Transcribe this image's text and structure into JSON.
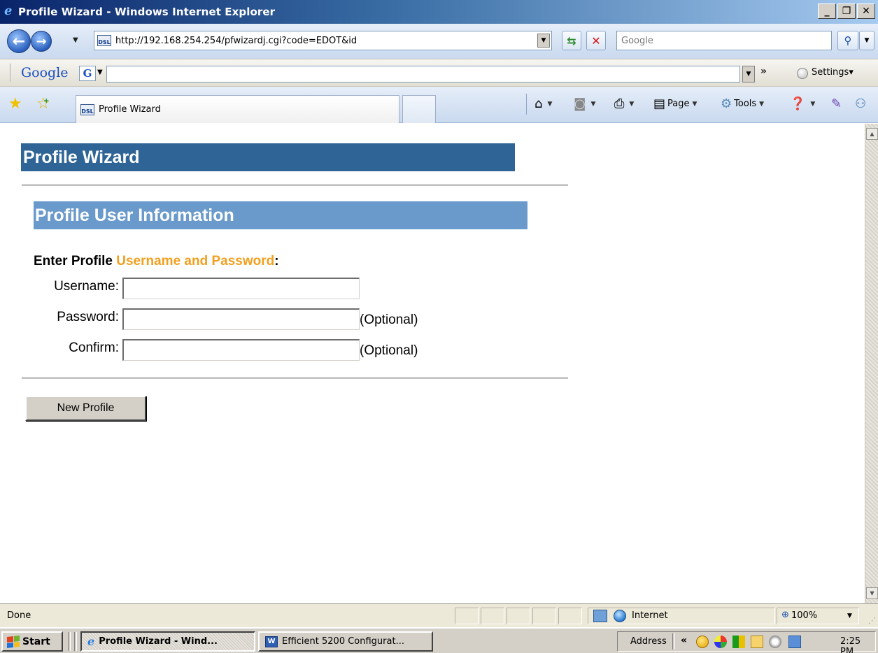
{
  "window": {
    "title": "Profile Wizard - Windows Internet Explorer",
    "minimize_glyph": "_",
    "maximize_glyph": "❐",
    "close_glyph": "✕"
  },
  "address_bar": {
    "url": "http://192.168.254.254/pfwizardj.cgi?code=EDOT&id",
    "site_icon_text": "DSL",
    "search_placeholder": "Google"
  },
  "google_toolbar": {
    "logo": "Google",
    "g_button": "G",
    "chevron": "»",
    "settings_label": "Settings"
  },
  "tabs": {
    "active_tab_label": "Profile Wizard"
  },
  "command_bar": {
    "page_label": "Page",
    "tools_label": "Tools"
  },
  "page": {
    "header_title": "Profile Wizard",
    "section_title": "Profile User Information",
    "prompt_prefix": "Enter Profile ",
    "prompt_highlight": "Username and Password",
    "prompt_suffix": ":",
    "username_label": "Username:",
    "username_value": "",
    "password_label": "Password:",
    "password_value": "",
    "password_hint": "(Optional)",
    "confirm_label": "Confirm:",
    "confirm_value": "",
    "confirm_hint": "(Optional)",
    "new_profile_button": "New Profile",
    "colors": {
      "header_bg": "#2e6596",
      "section_bg": "#6a9acb",
      "highlight": "#f0a020"
    }
  },
  "status_bar": {
    "status_text": "Done",
    "zone_text": "Internet",
    "zoom_text": "100%"
  },
  "taskbar": {
    "start_label": "Start",
    "tasks": [
      {
        "label": "Profile Wizard - Wind...",
        "icon": "ie-icon",
        "active": true
      },
      {
        "label": "Efficient 5200 Configurat...",
        "icon": "word-icon",
        "active": false
      }
    ],
    "tray_address_label": "Address",
    "tray_chevron": "«",
    "clock": "2:25 PM"
  }
}
